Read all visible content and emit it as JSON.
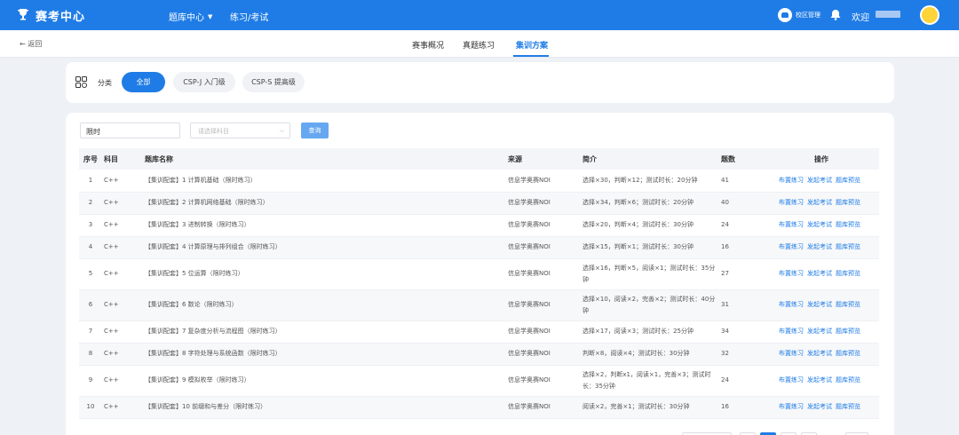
{
  "brand": {
    "name": "赛考中心",
    "icon": "trophy-icon"
  },
  "topnav": {
    "menu1": "题库中心",
    "menu2": "练习/考试"
  },
  "topright": {
    "admin": "校区管理",
    "welcome": "欢迎"
  },
  "subnav": {
    "back": "← 返回",
    "tabs": [
      "赛事概况",
      "真题练习",
      "集训方案"
    ],
    "active_tab": "集训方案"
  },
  "filter": {
    "label": "分类",
    "chips": [
      "全部",
      "CSP-J 入门级",
      "CSP-S 提高级"
    ],
    "active": "全部"
  },
  "search": {
    "input_value": "限时",
    "select_placeholder": "请选择科目",
    "query_button": "查询"
  },
  "table": {
    "headers": [
      "序号",
      "科目",
      "题库名称",
      "来源",
      "简介",
      "题数",
      "操作"
    ],
    "actions": [
      "布置练习",
      "发起考试",
      "题库预览"
    ],
    "rows": [
      {
        "idx": "1",
        "subject": "C++",
        "name": "【集训配套】1 计算机基础（限时练习）",
        "source": "信息学奥赛NOI",
        "intro": "选择×30，判断×12；测试时长：20分钟",
        "count": "41"
      },
      {
        "idx": "2",
        "subject": "C++",
        "name": "【集训配套】2 计算机网络基础（限时练习）",
        "source": "信息学奥赛NOI",
        "intro": "选择×34，判断×6；测试时长：20分钟",
        "count": "40"
      },
      {
        "idx": "3",
        "subject": "C++",
        "name": "【集训配套】3 进制转换（限时练习）",
        "source": "信息学奥赛NOI",
        "intro": "选择×20，判断×4；测试时长：30分钟",
        "count": "24"
      },
      {
        "idx": "4",
        "subject": "C++",
        "name": "【集训配套】4 计算原理与排列组合（限时练习）",
        "source": "信息学奥赛NOI",
        "intro": "选择×15，判断×1；测试时长：30分钟",
        "count": "16"
      },
      {
        "idx": "5",
        "subject": "C++",
        "name": "【集训配套】5 位运算（限时练习）",
        "source": "信息学奥赛NOI",
        "intro": "选择×16，判断×5，阅读×1；测试时长：35分钟",
        "count": "27"
      },
      {
        "idx": "6",
        "subject": "C++",
        "name": "【集训配套】6 数论（限时练习）",
        "source": "信息学奥赛NOI",
        "intro": "选择×10，阅读×2，完善×2；测试时长：40分钟",
        "count": "31"
      },
      {
        "idx": "7",
        "subject": "C++",
        "name": "【集训配套】7 复杂度分析与流程图（限时练习）",
        "source": "信息学奥赛NOI",
        "intro": "选择×17，阅读×3；测试时长：25分钟",
        "count": "34"
      },
      {
        "idx": "8",
        "subject": "C++",
        "name": "【集训配套】8 字符处理与系统函数（限时练习）",
        "source": "信息学奥赛NOI",
        "intro": "判断×8，阅读×4；测试时长：30分钟",
        "count": "32"
      },
      {
        "idx": "9",
        "subject": "C++",
        "name": "【集训配套】9 模拟枚举（限时练习）",
        "source": "信息学奥赛NOI",
        "intro": "选择×2，判断x1，阅读×1，完善×3；测试时长：35分钟",
        "count": "24"
      },
      {
        "idx": "10",
        "subject": "C++",
        "name": "【集训配套】10 前缀和与差分（限时练习）",
        "source": "信息学奥赛NOI",
        "intro": "阅读×2，完善×1；测试时长：30分钟",
        "count": "16"
      }
    ]
  },
  "colors": {
    "primary": "#1f7ce6",
    "link": "#1f7ce6",
    "background": "#eef1f6"
  }
}
